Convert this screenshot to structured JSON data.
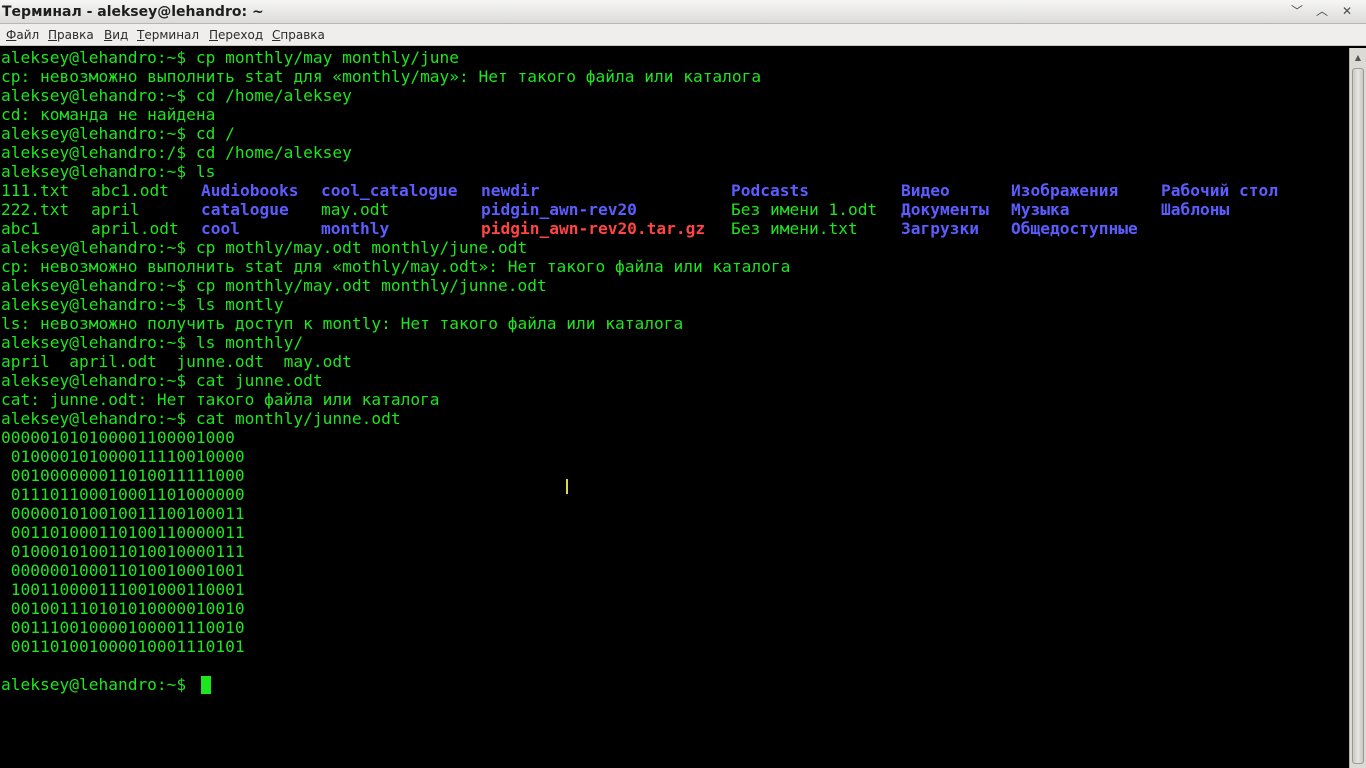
{
  "window": {
    "title": "Терминал - aleksey@lehandro: ~",
    "buttons": {
      "minimize": "﹀",
      "maximize": "︿",
      "close": "✕"
    }
  },
  "menu": {
    "items": [
      {
        "label": "Файл",
        "mnemonic": "Ф",
        "rest": "айл"
      },
      {
        "label": "Правка",
        "mnemonic": "П",
        "rest": "равка"
      },
      {
        "label": "Вид",
        "mnemonic": "В",
        "rest": "ид"
      },
      {
        "label": "Терминал",
        "mnemonic": "Т",
        "rest": "ерминал"
      },
      {
        "label": "Переход",
        "mnemonic": "П",
        "rest": "ереход"
      },
      {
        "label": "Справка",
        "mnemonic": "С",
        "rest": "правка"
      }
    ]
  },
  "colors": {
    "terminal_bg": "#000000",
    "text_green": "#1ee61e",
    "directory_blue": "#5c5cff",
    "archive_red": "#ff4444"
  },
  "terminal": {
    "lines": [
      "aleksey@lehandro:~$ cp monthly/may monthly/june",
      "cp: невозможно выполнить stat для «monthly/may»: Нет такого файла или каталога",
      "aleksey@lehandro:~$ cd /home/aleksey",
      "cd: команда не найдена",
      "aleksey@lehandro:~$ cd /",
      "aleksey@lehandro:/$ cd /home/aleksey",
      "aleksey@lehandro:~$ ls",
      null,
      null,
      null,
      "aleksey@lehandro:~$ cp mothly/may.odt monthly/june.odt",
      "cp: невозможно выполнить stat для «mothly/may.odt»: Нет такого файла или каталога",
      "aleksey@lehandro:~$ cp monthly/may.odt monthly/junne.odt",
      "aleksey@lehandro:~$ ls montly",
      "ls: невозможно получить доступ к montly: Нет такого файла или каталога",
      "aleksey@lehandro:~$ ls monthly/",
      "april  april.odt  junne.odt  may.odt",
      "aleksey@lehandro:~$ cat junne.odt",
      "cat: junne.odt: Нет такого файла или каталога",
      "aleksey@lehandro:~$ cat monthly/junne.odt",
      "000001010100001100001000",
      " 010000101000011110010000",
      " 001000000011010011111000",
      " 011101100010001101000000",
      " 000001010010011100100011",
      " 001101000110100110000011",
      " 010001010011010010000111",
      " 000000100011010010001001",
      " 100110000111001000110001",
      " 001001110101010000010010",
      " 001110010000100001110010",
      " 001101001000010001110101",
      "",
      "aleksey@lehandro:~$ "
    ],
    "ls_listing": {
      "columns": [
        [
          "111.txt",
          "222.txt",
          "abc1"
        ],
        [
          "abc1.odt",
          "april",
          "april.odt"
        ],
        [
          "Audiobooks",
          "catalogue",
          "cool"
        ],
        [
          "cool_catalogue",
          "may.odt",
          "monthly"
        ],
        [
          "newdir",
          "pidgin_awn-rev20",
          "pidgin_awn-rev20.tar.gz"
        ],
        [
          "Podcasts",
          "Без имени 1.odt",
          "Без имени.txt"
        ],
        [
          "Видео",
          "Документы",
          "Загрузки"
        ],
        [
          "Изображения",
          "Музыка",
          "Общедоступные"
        ],
        [
          "Рабочий стол",
          "Шаблоны",
          ""
        ]
      ],
      "types": [
        [
          "file",
          "file",
          "file"
        ],
        [
          "file",
          "file",
          "file"
        ],
        [
          "dir",
          "dir",
          "dir"
        ],
        [
          "dir",
          "file",
          "dir"
        ],
        [
          "dir",
          "dir",
          "archive"
        ],
        [
          "dir",
          "file",
          "file"
        ],
        [
          "dir",
          "dir",
          "dir"
        ],
        [
          "dir",
          "dir",
          "dir"
        ],
        [
          "dir",
          "dir",
          "file"
        ]
      ]
    }
  }
}
